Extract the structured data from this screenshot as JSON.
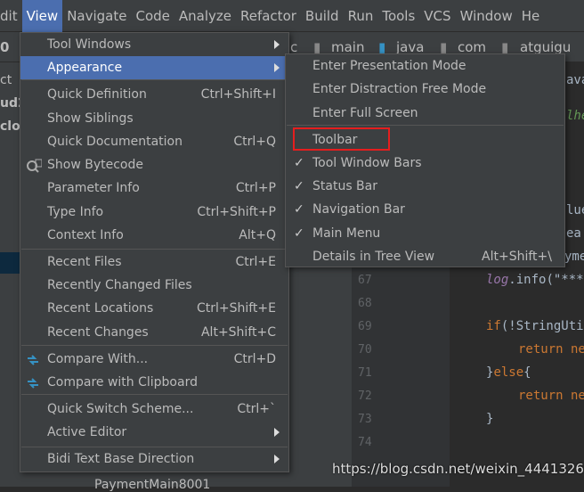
{
  "menubar": [
    "dit",
    "View",
    "Navigate",
    "Code",
    "Analyze",
    "Refactor",
    "Build",
    "Run",
    "Tools",
    "VCS",
    "Window",
    "He"
  ],
  "breadcrumb": [
    "c",
    "main",
    "java",
    "com",
    "atguigu"
  ],
  "editor": {
    "lines": [
      "67",
      "68",
      "69",
      "70",
      "71",
      "72",
      "73",
      "74"
    ],
    "code": {
      "l67a": "log",
      "l67b": ".info(\"***",
      "l69a": "if",
      "l69b": "(!StringUti",
      "l70": "return ne",
      "l71a": "}",
      "l71b": "else",
      "l71c": "{",
      "l72": "return ne",
      "l73": "}"
    },
    "right_fragments": {
      "ava": "ava",
      "lhe": "lhe",
      "lu": "lue",
      "ea": "ea",
      "yme": "yme"
    },
    "left_fragments": {
      "zero": "0",
      "ct": "ct",
      "ud2": "ud2",
      "clou": "clou",
      "s": "s",
      "payment": "PaymentMain8001"
    }
  },
  "view_menu": {
    "items": [
      {
        "label": "Tool Windows",
        "submenu": true
      },
      {
        "label": "Appearance",
        "submenu": true,
        "highlighted": true
      },
      {
        "label": "Quick Definition",
        "shortcut": "Ctrl+Shift+I"
      },
      {
        "label": "Show Siblings"
      },
      {
        "label": "Quick Documentation",
        "shortcut": "Ctrl+Q"
      },
      {
        "label": "Show Bytecode",
        "icon": "bytecode-icon"
      },
      {
        "label": "Parameter Info",
        "shortcut": "Ctrl+P"
      },
      {
        "label": "Type Info",
        "shortcut": "Ctrl+Shift+P"
      },
      {
        "label": "Context Info",
        "shortcut": "Alt+Q"
      },
      {
        "label": "Recent Files",
        "shortcut": "Ctrl+E"
      },
      {
        "label": "Recently Changed Files"
      },
      {
        "label": "Recent Locations",
        "shortcut": "Ctrl+Shift+E"
      },
      {
        "label": "Recent Changes",
        "shortcut": "Alt+Shift+C"
      },
      {
        "label": "Compare With...",
        "shortcut": "Ctrl+D",
        "icon": "compare-icon"
      },
      {
        "label": "Compare with Clipboard",
        "icon": "clipboard-compare-icon"
      },
      {
        "label": "Quick Switch Scheme...",
        "shortcut": "Ctrl+`"
      },
      {
        "label": "Active Editor",
        "submenu": true
      },
      {
        "label": "Bidi Text Base Direction",
        "submenu": true
      }
    ]
  },
  "appearance_menu": {
    "items": [
      {
        "label": "Enter Presentation Mode"
      },
      {
        "label": "Enter Distraction Free Mode"
      },
      {
        "label": "Enter Full Screen"
      },
      {
        "label": "Toolbar",
        "checked": false,
        "annotated": true
      },
      {
        "label": "Tool Window Bars",
        "checked": true
      },
      {
        "label": "Status Bar",
        "checked": true
      },
      {
        "label": "Navigation Bar",
        "checked": true
      },
      {
        "label": "Main Menu",
        "checked": true
      },
      {
        "label": "Details in Tree View",
        "shortcut": "Alt+Shift+\\"
      }
    ]
  },
  "colors": {
    "highlight": "#4b6eaf",
    "annotation": "#e51e1e",
    "menu_bg": "#3c3f41"
  },
  "watermark": "https://blog.csdn.net/weixin_44413260"
}
